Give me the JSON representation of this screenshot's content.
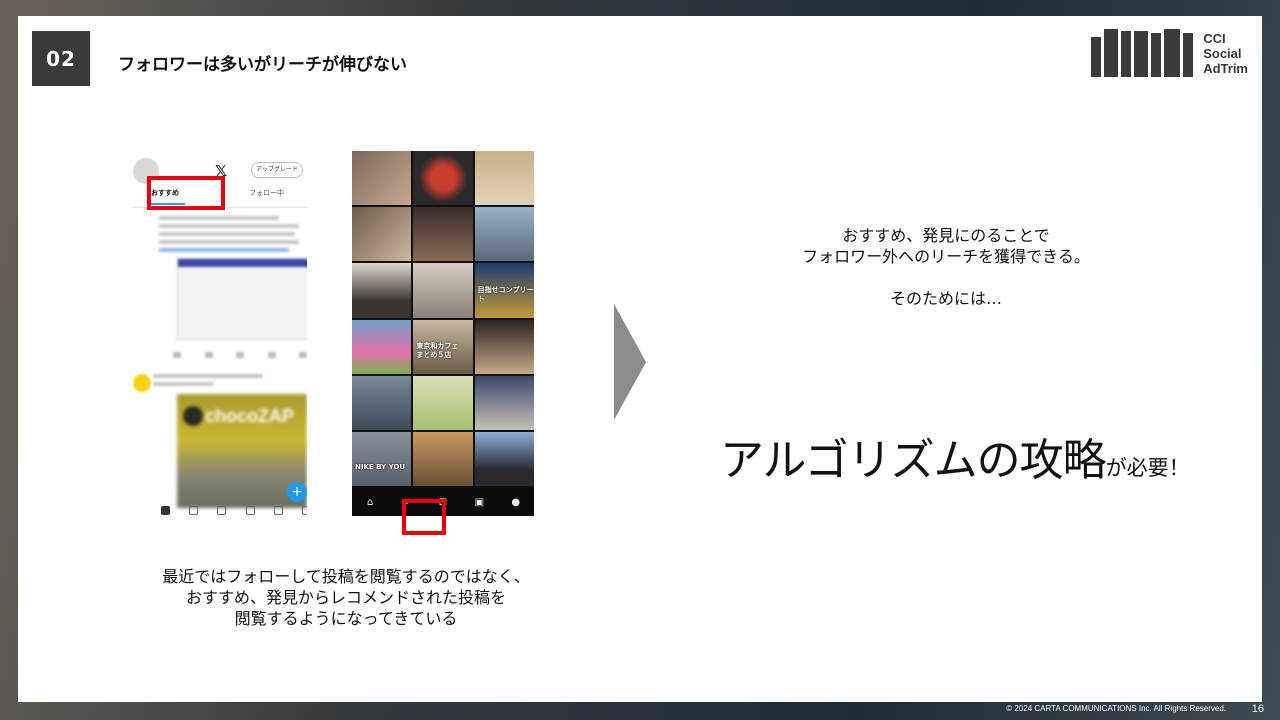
{
  "header": {
    "section_number": "02",
    "title": "フォロワーは多いがリーチが伸びない"
  },
  "logo": {
    "line1": "CCI",
    "line2": "Social",
    "line3": "AdTrim",
    "icon": "adtrim-logo-mark"
  },
  "phone_x": {
    "tab_recommended": "おすすめ",
    "tab_following": "フォロー中",
    "upgrade_button": "アップグレード",
    "brand_icon": "x-logo-icon",
    "promo_text": "chocoZAP"
  },
  "phone_instagram": {
    "caption_1": "目指せコンプリート",
    "caption_2": "東京和カフェ\nまとめ５店",
    "caption_3": "NIKE BY YOU"
  },
  "left_caption": "最近ではフォローして投稿を閲覧するのではなく、\nおすすめ、発見からレコメンドされた投稿を\n閲覧するようになってきている",
  "right_text": {
    "line1": "おすすめ、発見にのることで",
    "line2": "フォロワー外へのリーチを獲得できる。",
    "line3": "そのためには…"
  },
  "headline": {
    "main": "アルゴリズムの攻略",
    "suffix": "が必要！"
  },
  "footer": {
    "copyright": "© 2024 CARTA COMMUNICATIONS Inc.  All Rights Reserved.",
    "page": "16"
  },
  "colors": {
    "accent_red": "#e8000b",
    "dark": "#3a3a3a",
    "x_blue": "#1d9bf0"
  }
}
